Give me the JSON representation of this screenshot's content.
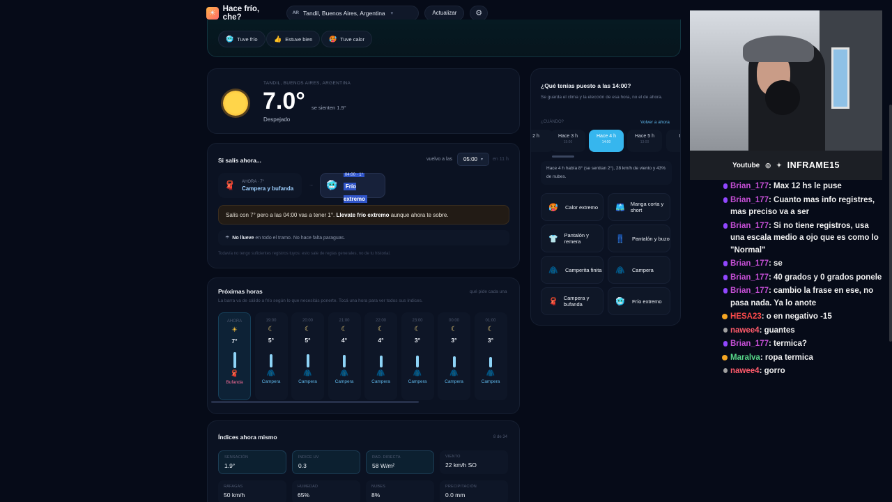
{
  "app": {
    "title": "Hace frío, che?",
    "icon": "sun-cloud-icon"
  },
  "location": {
    "country_code": "AR",
    "name": "Tandil, Buenos Aires, Argentina"
  },
  "toolbar": {
    "update_label": "Actualizar",
    "settings_icon": "gear-icon"
  },
  "feedback": {
    "buttons": [
      {
        "label": "Tuve frío",
        "icon": "cold-face-icon"
      },
      {
        "label": "Estuve bien",
        "icon": "thumbs-up-icon"
      },
      {
        "label": "Tuve calor",
        "icon": "hot-face-icon"
      }
    ]
  },
  "current": {
    "location": "TANDIL, BUENOS AIRES, ARGENTINA",
    "temp": "7.0°",
    "feels": "se sienten 1.9°",
    "condition": "Despejado"
  },
  "leave": {
    "title": "Si salís ahora...",
    "return_label": "vuelvo a las",
    "return_value": "05:00",
    "return_in": "en 11 h",
    "now_small": "AHORA · 7°",
    "now_main": "Campera y bufanda",
    "then_small": "04:00 · 1°",
    "then_main": "Frío extremo",
    "warning_pre": "Salís con 7° pero a las 04:00 vas a tener 1°.",
    "warning_bold": "Llevate frío extremo",
    "warning_post": "aunque ahora te sobre.",
    "rain_bold": "No llueve",
    "rain_text": "en todo el tramo. No hace falta paraguas.",
    "footer": "Todavía no tengo suficientes registros tuyos: esto sale de reglas generales, no de tu historial."
  },
  "hours": {
    "title": "Próximas horas",
    "subtitle": "La barra va de cálido a frío según lo que necesitás ponerte. Tocá una hora para ver todos sus índices.",
    "right_label": "qué pide cada una",
    "items": [
      {
        "time": "AHORA",
        "icon": "sun-icon",
        "temp": "7°",
        "label": "Bufanda",
        "bar": 0.75
      },
      {
        "time": "19:00",
        "icon": "moon-icon",
        "temp": "5°",
        "label": "Campera",
        "bar": 0.55
      },
      {
        "time": "20:00",
        "icon": "moon-icon",
        "temp": "5°",
        "label": "Campera",
        "bar": 0.55
      },
      {
        "time": "21:00",
        "icon": "moon-icon",
        "temp": "4°",
        "label": "Campera",
        "bar": 0.5
      },
      {
        "time": "22:00",
        "icon": "moon-icon",
        "temp": "4°",
        "label": "Campera",
        "bar": 0.45
      },
      {
        "time": "23:00",
        "icon": "moon-icon",
        "temp": "3°",
        "label": "Campera",
        "bar": 0.45
      },
      {
        "time": "00:00",
        "icon": "moon-icon",
        "temp": "3°",
        "label": "Campera",
        "bar": 0.4
      },
      {
        "time": "01:00",
        "icon": "moon-icon",
        "temp": "3°",
        "label": "Campera",
        "bar": 0.35
      }
    ]
  },
  "indices": {
    "title": "Índices ahora mismo",
    "count": "8 de 34",
    "items": [
      {
        "key": "SENSACIÓN",
        "value": "1.9°"
      },
      {
        "key": "ÍNDICE UV",
        "value": "0.3"
      },
      {
        "key": "RAD. DIRECTA",
        "value": "58 W/m²"
      },
      {
        "key": "VIENTO",
        "value": "22 km/h SO"
      },
      {
        "key": "RÁFAGAS",
        "value": "50 km/h"
      },
      {
        "key": "HUMEDAD",
        "value": "65%"
      },
      {
        "key": "NUBES",
        "value": "8%"
      },
      {
        "key": "PRECIPITACIÓN",
        "value": "0.0 mm"
      }
    ]
  },
  "wear": {
    "title": "¿Qué tenías puesto a las 14:00?",
    "subtitle": "Se guarda el clima y la elección de esa hora, no el de ahora.",
    "when_label": "¿CUÁNDO?",
    "back_label": "Volver a ahora",
    "chips": [
      {
        "label": "2 h",
        "time": ""
      },
      {
        "label": "Hace 3 h",
        "time": "15:00"
      },
      {
        "label": "Hace 4 h",
        "time": "14:00"
      },
      {
        "label": "Hace 5 h",
        "time": "13:00"
      },
      {
        "label": "Hac",
        "time": "12"
      }
    ],
    "info": "Hace 4 h había 8° (se sentían 2°), 28 km/h de viento y 43% de nubes.",
    "options": [
      {
        "label": "Calor extremo",
        "icon": "hot-face-icon"
      },
      {
        "label": "Manga corta y short",
        "icon": "shorts-icon"
      },
      {
        "label": "Pantalón y remera",
        "icon": "tshirt-icon"
      },
      {
        "label": "Pantalón y buzo",
        "icon": "jeans-icon"
      },
      {
        "label": "Camperita finita",
        "icon": "light-jacket-icon"
      },
      {
        "label": "Campera",
        "icon": "jacket-icon"
      },
      {
        "label": "Campera y bufanda",
        "icon": "scarf-icon"
      },
      {
        "label": "Frío extremo",
        "icon": "cold-face-icon"
      }
    ]
  },
  "stream": {
    "platform": "Youtube",
    "handle": "INFRAME15",
    "chat": [
      {
        "user": "Brian_177",
        "text": ": Max 12 hs le puse",
        "badge": "purple",
        "cls": "u-brian"
      },
      {
        "user": "Brian_177",
        "text": ": Cuanto mas info registres, mas preciso va a ser",
        "badge": "purple",
        "cls": "u-brian"
      },
      {
        "user": "Brian_177",
        "text": ": Si no tiene registros, usa una escala medio a ojo que es como lo \"Normal\"",
        "badge": "purple",
        "cls": "u-brian"
      },
      {
        "user": "Brian_177",
        "text": ": se",
        "badge": "purple",
        "cls": "u-brian"
      },
      {
        "user": "Brian_177",
        "text": ": 40 grados y 0 grados ponele",
        "badge": "purple",
        "cls": "u-brian"
      },
      {
        "user": "Brian_177",
        "text": ": cambio la frase en ese, no pasa nada. Ya lo anote",
        "badge": "purple",
        "cls": "u-brian"
      },
      {
        "user": "HESA23",
        "text": ": o en negativo -15",
        "badge": "gold",
        "cls": "u-hesa"
      },
      {
        "user": "nawee4",
        "text": ": guantes",
        "badge": "grey",
        "cls": "u-nawee"
      },
      {
        "user": "Brian_177",
        "text": ": termica?",
        "badge": "purple",
        "cls": "u-brian"
      },
      {
        "user": "Maralva",
        "text": ": ropa termica",
        "badge": "gold",
        "cls": "u-maralva"
      },
      {
        "user": "nawee4",
        "text": ": gorro",
        "badge": "grey",
        "cls": "u-nawee"
      }
    ]
  }
}
